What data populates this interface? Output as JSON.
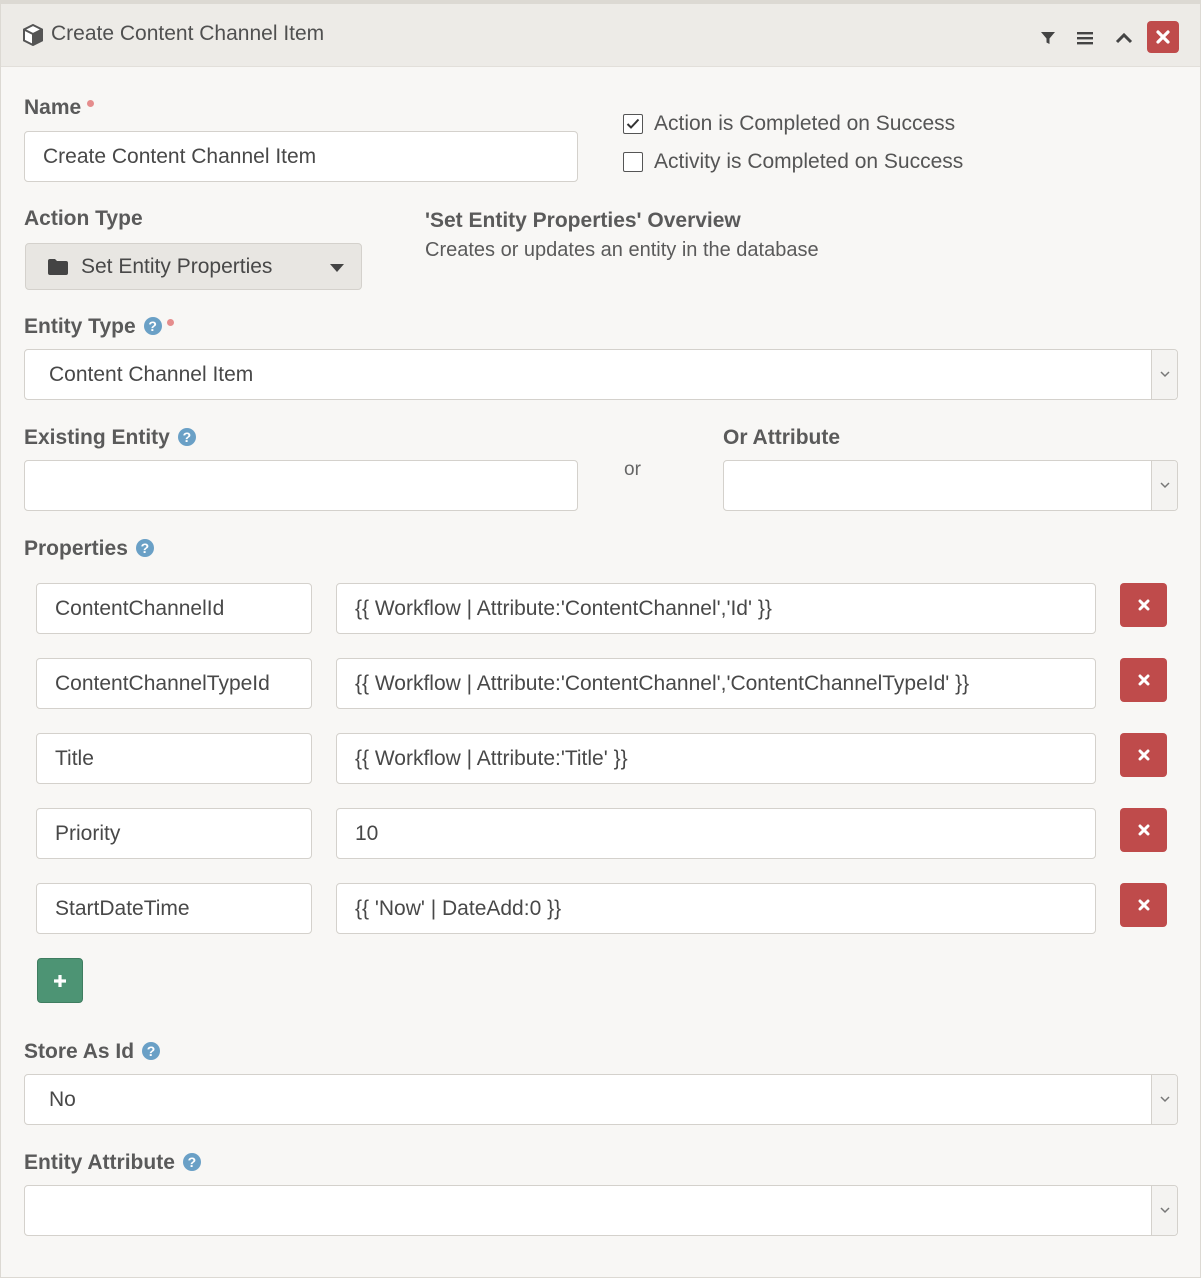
{
  "header": {
    "title": "Create Content Channel Item",
    "icons": [
      "cube-icon",
      "filter-icon",
      "menu-icon",
      "chevron-up-icon",
      "close-icon"
    ]
  },
  "name": {
    "label": "Name",
    "value": "Create Content Channel Item"
  },
  "checkboxes": [
    {
      "label": "Action is Completed on Success",
      "checked": true
    },
    {
      "label": "Activity is Completed on Success",
      "checked": false
    }
  ],
  "action_type": {
    "label": "Action Type",
    "value": "Set Entity Properties",
    "icon": "folder-icon"
  },
  "overview": {
    "title": "'Set Entity Properties' Overview",
    "description": "Creates or updates an entity in the database"
  },
  "entity_type": {
    "label": "Entity Type",
    "value": "Content Channel Item"
  },
  "existing_entity": {
    "label": "Existing Entity",
    "value": ""
  },
  "or_text": "or",
  "or_attribute": {
    "label": "Or Attribute",
    "value": ""
  },
  "properties": {
    "label": "Properties",
    "rows": [
      {
        "key": "ContentChannelId",
        "value": "{{ Workflow | Attribute:'ContentChannel','Id' }}"
      },
      {
        "key": "ContentChannelTypeId",
        "value": "{{ Workflow | Attribute:'ContentChannel','ContentChannelTypeId' }}"
      },
      {
        "key": "Title",
        "value": "{{ Workflow | Attribute:'Title' }}"
      },
      {
        "key": "Priority",
        "value": "10"
      },
      {
        "key": "StartDateTime",
        "value": "{{ 'Now' | DateAdd:0 }}"
      }
    ]
  },
  "store_as_id": {
    "label": "Store As Id",
    "value": "No"
  },
  "entity_attribute": {
    "label": "Entity Attribute",
    "value": ""
  },
  "colors": {
    "danger": "#bf4b4b",
    "success": "#4d9474",
    "help": "#6aa0c6",
    "required": "#e58d8d"
  }
}
